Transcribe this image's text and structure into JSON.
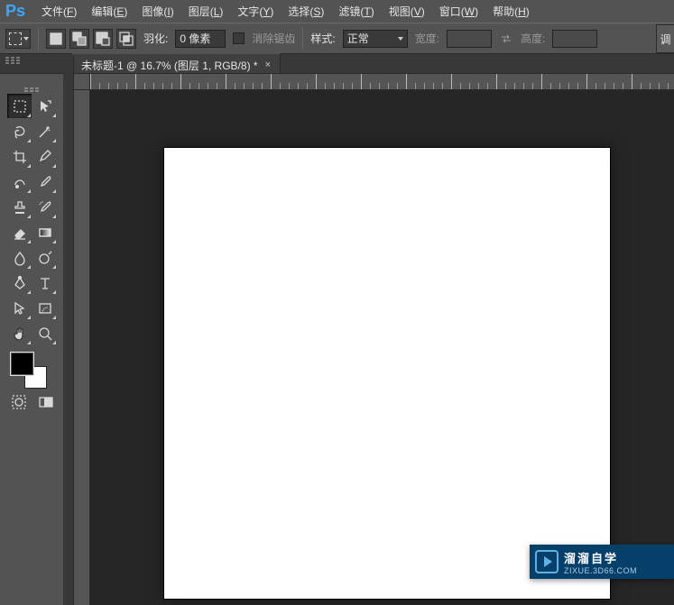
{
  "app": {
    "logo_text": "Ps"
  },
  "menu": {
    "items": [
      {
        "label": "文件",
        "key": "F"
      },
      {
        "label": "编辑",
        "key": "E"
      },
      {
        "label": "图像",
        "key": "I"
      },
      {
        "label": "图层",
        "key": "L"
      },
      {
        "label": "文字",
        "key": "Y"
      },
      {
        "label": "选择",
        "key": "S"
      },
      {
        "label": "滤镜",
        "key": "T"
      },
      {
        "label": "视图",
        "key": "V"
      },
      {
        "label": "窗口",
        "key": "W"
      },
      {
        "label": "帮助",
        "key": "H"
      }
    ]
  },
  "options": {
    "feather_label": "羽化:",
    "feather_value": "0 像素",
    "antialias_label": "消除锯齿",
    "style_label": "样式:",
    "style_value": "正常",
    "width_label": "宽度:",
    "width_value": "",
    "height_label": "高度:",
    "height_value": "",
    "adjust_label": "调"
  },
  "tabs": {
    "items": [
      {
        "title": "未标题-1 @ 16.7% (图层 1, RGB/8) *"
      }
    ]
  },
  "tools": {
    "rows": [
      [
        "marquee-tool",
        "move-tool"
      ],
      [
        "lasso-tool",
        "magic-wand-tool"
      ],
      [
        "crop-tool",
        "eyedropper-tool"
      ],
      [
        "spot-heal-tool",
        "brush-tool"
      ],
      [
        "stamp-tool",
        "history-brush-tool"
      ],
      [
        "eraser-tool",
        "gradient-tool"
      ],
      [
        "blur-tool",
        "dodge-tool"
      ],
      [
        "pen-tool",
        "type-tool"
      ],
      [
        "path-select-tool",
        "shape-tool"
      ],
      [
        "hand-tool",
        "zoom-tool"
      ]
    ],
    "footer": [
      "quick-mask-icon",
      "screen-mode-icon"
    ]
  },
  "colors": {
    "foreground": "#000000",
    "background": "#ffffff"
  },
  "canvas": {
    "doc_name": "未标题-1",
    "zoom": "16.7%"
  },
  "watermark": {
    "brand": "溜溜自学",
    "sub": "ZIXUE.3D66.COM"
  }
}
